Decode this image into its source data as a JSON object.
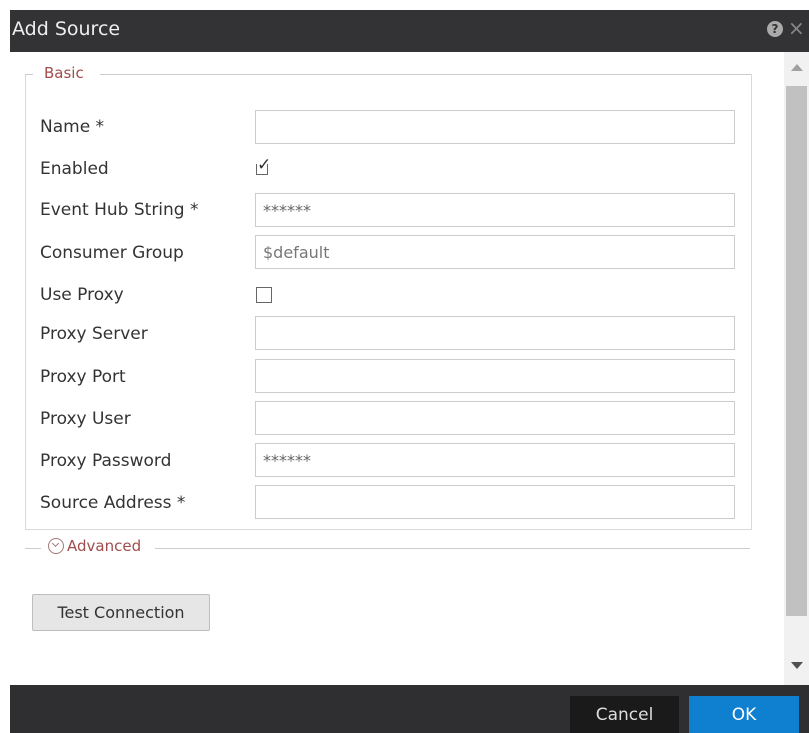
{
  "dialog": {
    "title": "Add Source"
  },
  "basic": {
    "legend": "Basic",
    "fields": {
      "name": {
        "label": "Name *",
        "value": ""
      },
      "enabled": {
        "label": "Enabled",
        "checked": true
      },
      "event_hub_string": {
        "label": "Event Hub String *",
        "value": "******"
      },
      "consumer_group": {
        "label": "Consumer Group",
        "placeholder": "$default"
      },
      "use_proxy": {
        "label": "Use Proxy",
        "checked": false
      },
      "proxy_server": {
        "label": "Proxy Server",
        "value": ""
      },
      "proxy_port": {
        "label": "Proxy Port",
        "value": ""
      },
      "proxy_user": {
        "label": "Proxy User",
        "value": ""
      },
      "proxy_password": {
        "label": "Proxy Password",
        "value": "******"
      },
      "source_address": {
        "label": "Source Address *",
        "value": ""
      }
    }
  },
  "advanced": {
    "label": "Advanced",
    "icon": "chevron-circle-down-icon"
  },
  "buttons": {
    "test_connection": "Test Connection",
    "cancel": "Cancel",
    "ok": "OK"
  },
  "icons": {
    "check": "✓",
    "help": "?",
    "close": "×"
  },
  "colors": {
    "ok_button": "#0f7fcf",
    "legend_text": "#a04c4c",
    "titlebar": "#333335"
  }
}
